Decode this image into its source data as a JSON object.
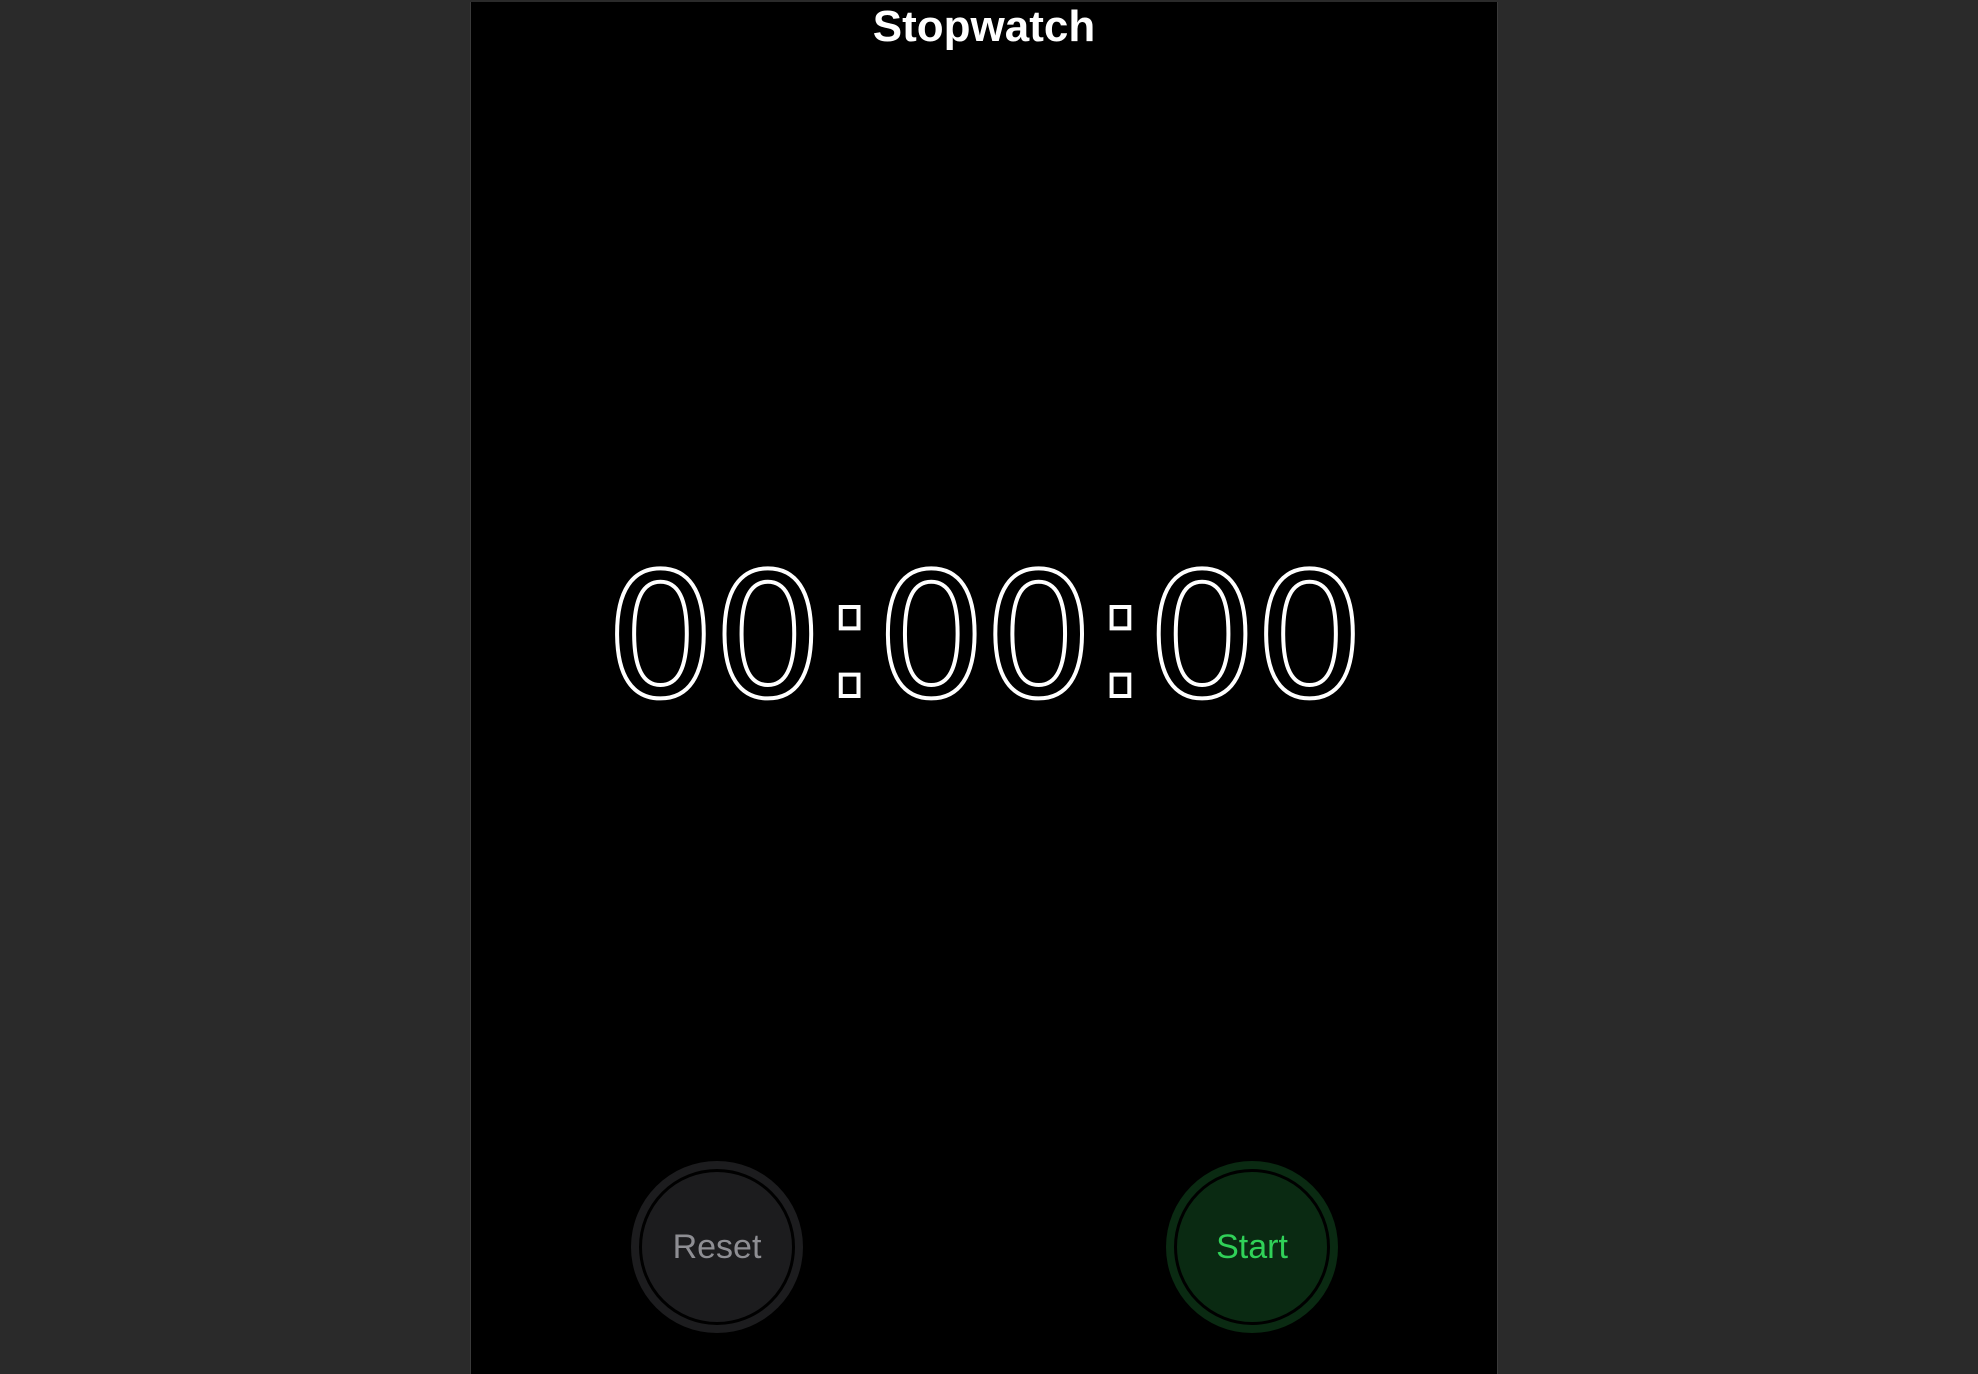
{
  "app": {
    "title": "Stopwatch",
    "time": "00:00:00"
  },
  "controls": {
    "reset_label": "Reset",
    "start_label": "Start"
  },
  "colors": {
    "background": "#000000",
    "outer_background": "#2a2a2a",
    "start_accent": "#30d158",
    "start_fill": "#0a2a12",
    "reset_text": "#8e8e93",
    "reset_fill": "#1c1c1e"
  }
}
